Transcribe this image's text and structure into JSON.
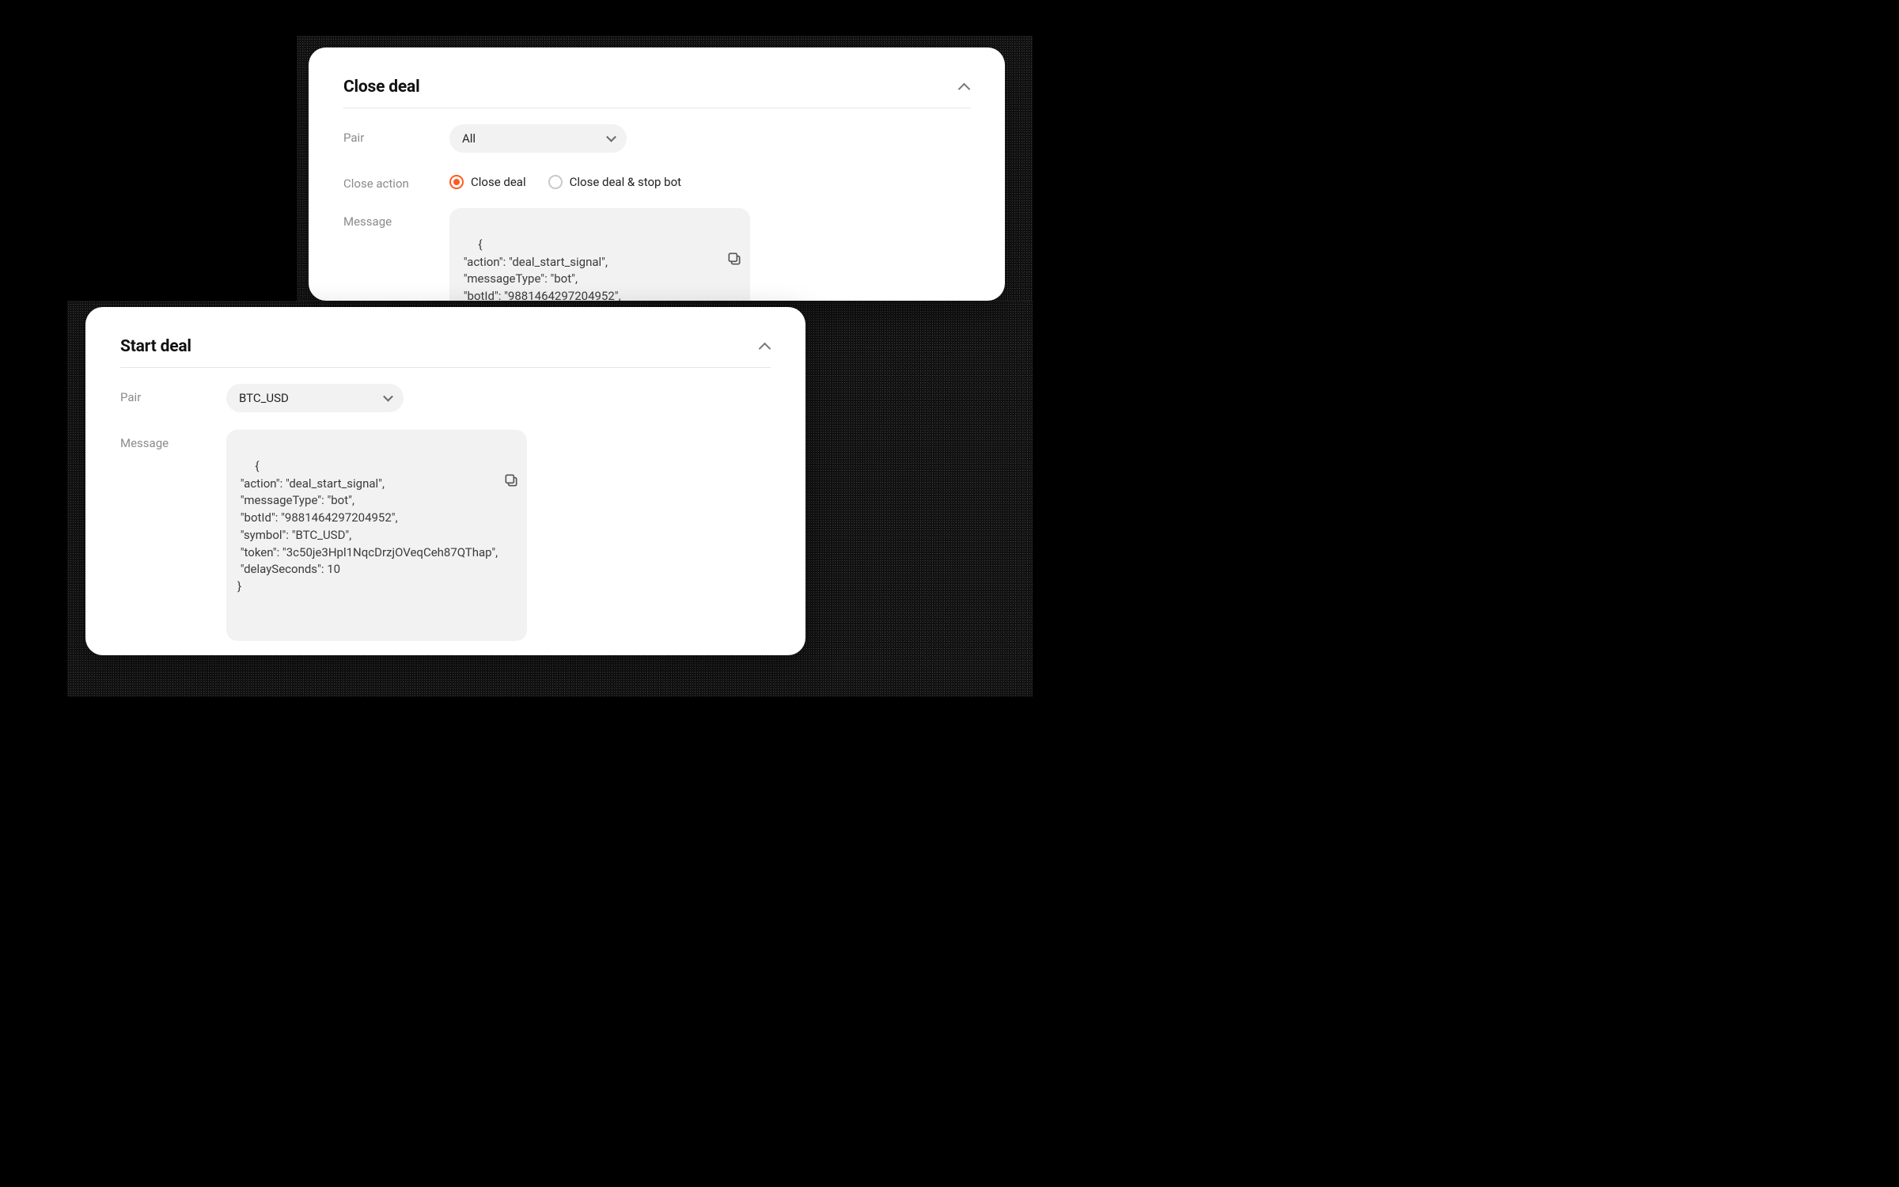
{
  "close_deal": {
    "title": "Close deal",
    "pair_label": "Pair",
    "pair_value": "All",
    "action_label": "Close action",
    "radio_close": "Close deal",
    "radio_close_stop": "Close deal & stop bot",
    "message_label": "Message",
    "message_text": "{\n \"action\": \"deal_start_signal\",\n \"messageType\": \"bot\",\n \"botId\": \"9881464297204952\","
  },
  "start_deal": {
    "title": "Start deal",
    "pair_label": "Pair",
    "pair_value": "BTC_USD",
    "message_label": "Message",
    "message_text": "{\n \"action\": \"deal_start_signal\",\n \"messageType\": \"bot\",\n \"botId\": \"9881464297204952\",\n \"symbol\": \"BTC_USD\",\n \"token\": \"3c50je3Hpl1NqcDrzjOVeqCeh87QThap\",\n \"delaySeconds\": 10\n}"
  }
}
